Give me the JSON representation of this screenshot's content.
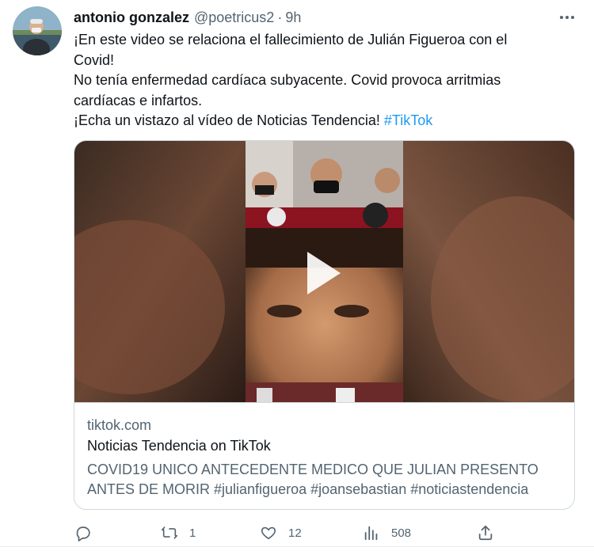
{
  "tweet": {
    "author_name": "antonio gonzalez",
    "handle": "@poetricus2",
    "separator": "·",
    "time": "9h",
    "text_lines": [
      "¡En este video se relaciona el fallecimiento de Julián Figueroa con el",
      "Covid!",
      "No tenía enfermedad cardíaca subyacente. Covid provoca arritmias",
      "cardíacas e infartos.",
      "¡Echa un vistazo al vídeo de Noticias Tendencia! "
    ],
    "hashtag": "#TikTok"
  },
  "card": {
    "domain": "tiktok.com",
    "title": "Noticias Tendencia on TikTok",
    "description_lines": [
      "COVID19 UNICO ANTECEDENTE MEDICO QUE JULIAN PRESENTO",
      "ANTES DE MORIR #julianfigueroa #joansebastian #noticiastendencia"
    ]
  },
  "actions": {
    "reply_count": "",
    "retweet_count": "1",
    "like_count": "12",
    "views_count": "508"
  },
  "icons": {
    "more": "more-dots-icon",
    "reply": "reply-icon",
    "retweet": "retweet-icon",
    "like": "heart-icon",
    "views": "analytics-icon",
    "share": "share-icon",
    "play": "play-icon"
  },
  "colors": {
    "link": "#1d9bf0",
    "text": "#0f1419",
    "secondary": "#536471",
    "border": "#cfd9de"
  }
}
